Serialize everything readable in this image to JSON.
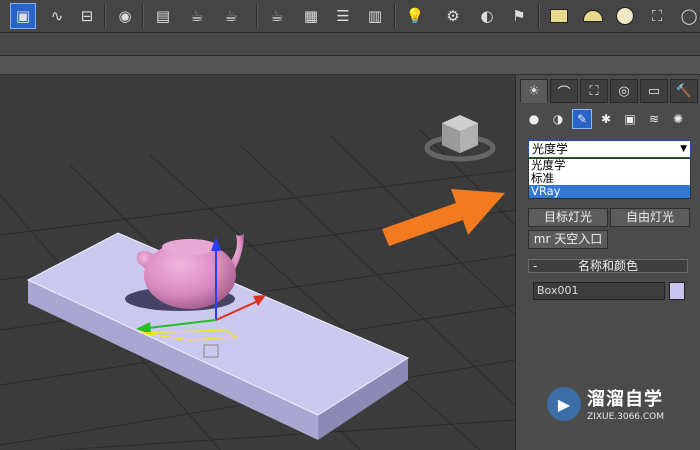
{
  "toolbar": {
    "icons": [
      "select-window-icon",
      "curve-editor-icon",
      "schematic-icon",
      "material-editor-icon",
      "render-setup-icon",
      "render-frame-icon",
      "teapot-render-icon",
      "teapot-small-icon",
      "teapot-render2-icon",
      "render-window-icon",
      "list-icon",
      "layer-icon",
      "light-bulb-icon",
      "camera-icon",
      "sphere-light-icon",
      "video-camera-icon",
      "box-primitive-icon",
      "dome-icon",
      "circle-icon",
      "basket-icon"
    ]
  },
  "command_panel": {
    "tabs": [
      "create",
      "modify",
      "hierarchy",
      "motion",
      "display",
      "utilities"
    ],
    "sub_icons": [
      "geometry",
      "shapes",
      "lights",
      "cameras",
      "helpers",
      "space-warps",
      "systems"
    ],
    "dropdown": {
      "value": "光度学"
    },
    "dropdown_options": [
      "光度学",
      "标准",
      "VRay"
    ],
    "buttons": {
      "target_light": "目标灯光",
      "free_light": "自由灯光",
      "sky_portal": "mr 天空入口"
    },
    "rollout": {
      "minus": "-",
      "title": "名称和颜色"
    },
    "name_field": "Box001",
    "swatch_color": "#c8c4ef"
  },
  "watermark": {
    "title": "溜溜自学",
    "url": "ZIXUE.3066.COM"
  },
  "colors": {
    "accent": "#2a64c8",
    "arrow": "#f47a20",
    "teapot": "#d98bbf",
    "box": "#c8c6ee"
  }
}
